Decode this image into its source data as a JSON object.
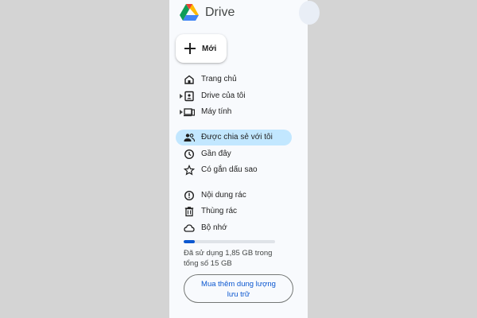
{
  "app": {
    "title": "Drive"
  },
  "new_button": {
    "label": "Mới"
  },
  "nav": {
    "items": [
      {
        "label": "Trang chủ",
        "icon": "home-icon"
      },
      {
        "label": "Drive của tôi",
        "icon": "my-drive-icon"
      },
      {
        "label": "Máy tính",
        "icon": "computer-icon"
      },
      {
        "label": "Được chia sẻ với tôi",
        "icon": "shared-people-icon",
        "active": true
      },
      {
        "label": "Gần đây",
        "icon": "clock-icon"
      },
      {
        "label": "Có gắn dấu sao",
        "icon": "star-icon"
      },
      {
        "label": "Nội dung rác",
        "icon": "spam-icon"
      },
      {
        "label": "Thùng rác",
        "icon": "trash-icon"
      },
      {
        "label": "Bộ nhớ",
        "icon": "cloud-icon"
      }
    ]
  },
  "storage": {
    "used_fraction": 0.12,
    "line1": "Đã sử dụng 1,85 GB trong",
    "line2": "tổng số 15 GB"
  },
  "buy_button": {
    "line1": "Mua thêm dung lượng",
    "line2": "lưu trữ"
  },
  "colors": {
    "active_bg": "#c2e7ff",
    "accent": "#0b57d0",
    "sidebar_bg": "#f8fafd",
    "page_bg": "#d4d4d4"
  }
}
